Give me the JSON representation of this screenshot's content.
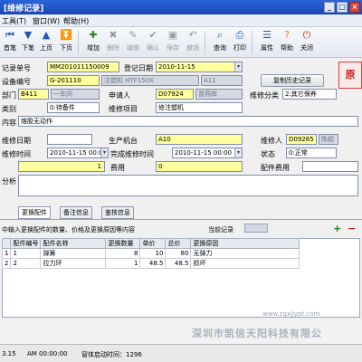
{
  "window": {
    "title": "[维修记录]"
  },
  "menu": {
    "items": [
      "工具(T)",
      "窗口(W)",
      "帮助(H)"
    ]
  },
  "toolbar": {
    "buttons": [
      {
        "label": "首笔",
        "enabled": true,
        "icon": "first-record-icon"
      },
      {
        "label": "下笔",
        "enabled": true,
        "icon": "next-record-icon"
      },
      {
        "label": "上页",
        "enabled": true,
        "icon": "previous-page-icon"
      },
      {
        "label": "下页",
        "enabled": true,
        "icon": "next-page-icon"
      },
      {
        "label": "增加",
        "enabled": true,
        "icon": "add-icon"
      },
      {
        "label": "删除",
        "enabled": false,
        "icon": "delete-icon"
      },
      {
        "label": "编辑",
        "enabled": false,
        "icon": "edit-icon"
      },
      {
        "label": "确认",
        "enabled": false,
        "icon": "confirm-icon"
      },
      {
        "label": "保存",
        "enabled": false,
        "icon": "save-icon"
      },
      {
        "label": "撤销",
        "enabled": false,
        "icon": "undo-icon"
      },
      {
        "label": "查询",
        "enabled": true,
        "icon": "query-icon"
      },
      {
        "label": "打印",
        "enabled": true,
        "icon": "print-icon"
      },
      {
        "label": "属性",
        "enabled": true,
        "icon": "properties-icon"
      },
      {
        "label": "帮助",
        "enabled": true,
        "icon": "help-icon"
      },
      {
        "label": "关闭",
        "enabled": true,
        "icon": "close-icon"
      }
    ]
  },
  "form": {
    "record_no_label": "记录单号",
    "record_no": "MM201011150009",
    "date_label": "登记日期",
    "date": "2010-11-15",
    "copy_history_btn": "复制历史记录",
    "stamp": "原",
    "equipment_no_label": "设备编号",
    "equipment_no": "G-201110",
    "equipment_name": "注塑机 HTF150X",
    "equipment_model": "A11",
    "dept_label": "部门",
    "dept_code": "B411",
    "dept_name": "一车间",
    "applicant_label": "申请人",
    "applicant_code": "D07924",
    "applicant_name": "曾燕辉",
    "repair_type_label": "维修分类",
    "repair_type": "2:其它保养",
    "category_label": "类别",
    "category": "0:待备件",
    "repair_item_label": "维修项目",
    "repair_item": "修注塑机",
    "content_label": "内容",
    "content": "熔胶无动作",
    "repair_date_label": "维修日期",
    "repair_date": "",
    "production_machine_label": "生产机台",
    "production_machine": "A10",
    "repairer_label": "维修人",
    "repairer_code": "D09265",
    "repairer_name": "陈超",
    "repair_time_label": "维修时间",
    "repair_time": "2010-11-15 00:00",
    "complete_time_label": "完成维修时间",
    "complete_time": "2010-11-15 00:00",
    "status_label": "状态",
    "status": "0:正常",
    "hours_value": "1",
    "cost_label": "费用",
    "cost_value": "0",
    "parts_cost_label": "配件费用",
    "analysis_label": "分析"
  },
  "tabs": [
    {
      "label": "更换配件",
      "active": true
    },
    {
      "label": "备注信息",
      "active": false
    },
    {
      "label": "鉴核信息",
      "active": false
    }
  ],
  "parts_section": {
    "hint": "中输入更换配件的数量、价格及更换原因等内容",
    "current_record_label": "当前记录",
    "add_symbol": "+",
    "remove_symbol": "−"
  },
  "grid": {
    "columns": [
      "",
      "配件编号",
      "配件名称",
      "更换数量",
      "单价",
      "总价",
      "更换原因"
    ],
    "rows": [
      [
        "1",
        "1",
        "弹簧",
        "8",
        "10",
        "80",
        "无弹力"
      ],
      [
        "2",
        "2",
        "拉力环",
        "1",
        "48.5",
        "48.5",
        "损坏"
      ]
    ]
  },
  "watermark": {
    "company": "深圳市凯信天阳科技有限公",
    "url": "www.zgxjjypt.com"
  },
  "statusbar": {
    "left": "3.15",
    "time": "AM 00:00:00",
    "startup": "窗体启动时间：1296"
  }
}
